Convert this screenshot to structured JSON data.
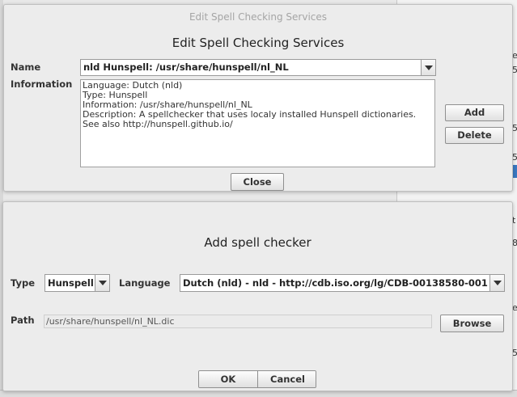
{
  "background": {
    "fragments": [
      "el",
      "5",
      "5",
      "5",
      "t",
      "8",
      "e",
      "5"
    ]
  },
  "edit_dialog": {
    "window_title": "Edit Spell Checking Services",
    "heading": "Edit Spell Checking Services",
    "name_label": "Name",
    "name_value": "nld Hunspell: /usr/share/hunspell/nl_NL",
    "information_label": "Information",
    "information_lines": [
      "Language: Dutch (nld)",
      "Type: Hunspell",
      "Information: /usr/share/hunspell/nl_NL",
      "Description: A spellchecker that uses localy installed Hunspell dictionaries.",
      "See also http://hunspell.github.io/"
    ],
    "add_label": "Add",
    "delete_label": "Delete",
    "close_label": "Close"
  },
  "add_dialog": {
    "heading": "Add spell checker",
    "type_label": "Type",
    "type_value": "Hunspell",
    "language_label": "Language",
    "language_value": "Dutch (nld) - nld - http://cdb.iso.org/lg/CDB-00138580-001",
    "path_label": "Path",
    "path_value": "/usr/share/hunspell/nl_NL.dic",
    "browse_label": "Browse",
    "ok_label": "OK",
    "cancel_label": "Cancel"
  }
}
